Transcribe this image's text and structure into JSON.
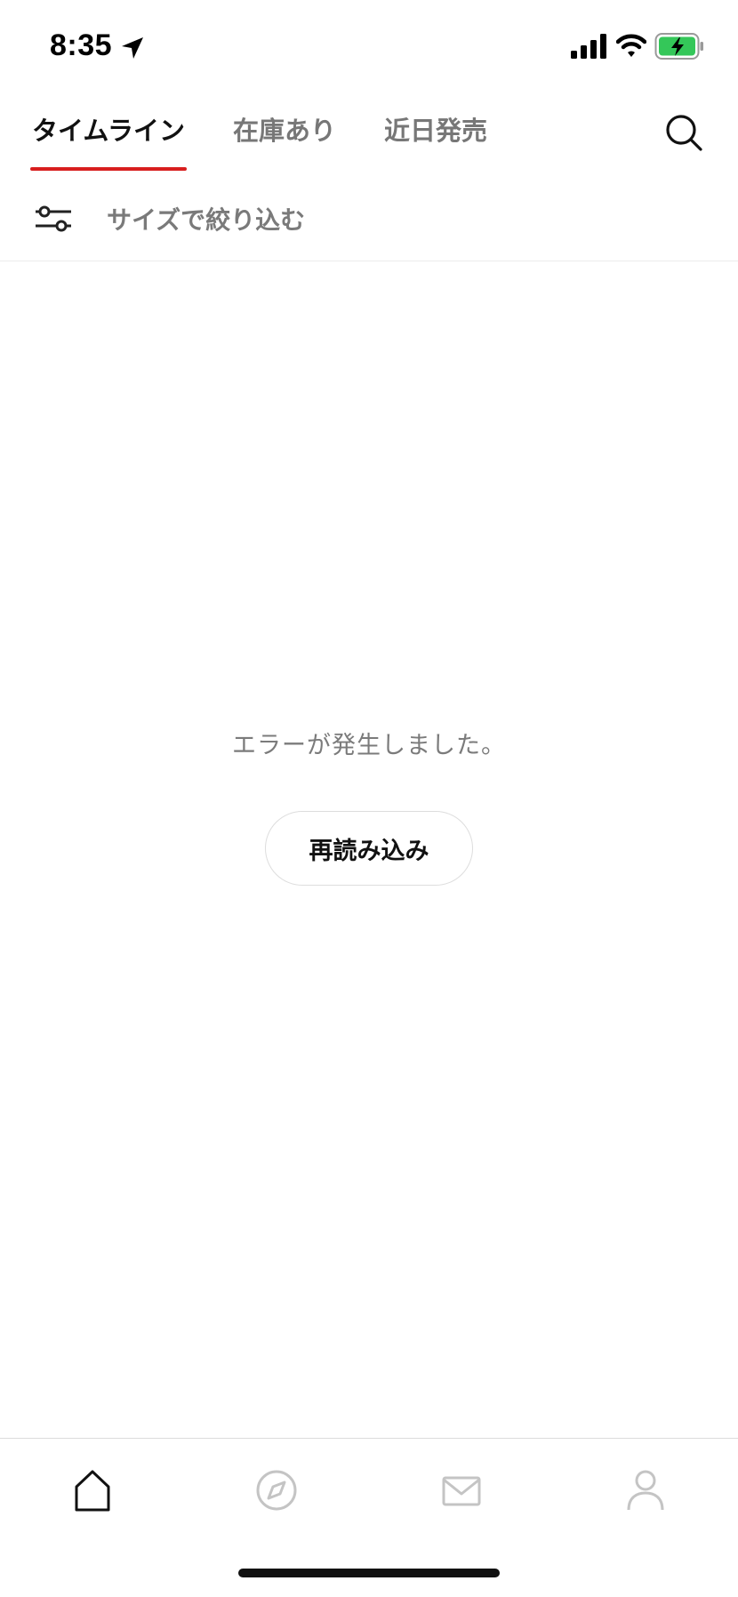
{
  "status_bar": {
    "time": "8:35",
    "icons": [
      "location-arrow-icon",
      "cellular-signal-icon",
      "wifi-icon",
      "battery-charging-icon"
    ],
    "battery_color": "#34c759"
  },
  "tabs": [
    {
      "label": "タイムライン",
      "active": true
    },
    {
      "label": "在庫あり",
      "active": false
    },
    {
      "label": "近日発売",
      "active": false
    }
  ],
  "accent_color": "#d81e1e",
  "search_icon": "search-icon",
  "filter": {
    "icon": "sliders-icon",
    "label": "サイズで絞り込む"
  },
  "error": {
    "message": "エラーが発生しました。",
    "reload_label": "再読み込み"
  },
  "bottom_nav": [
    {
      "icon": "home-icon",
      "active": true
    },
    {
      "icon": "compass-icon",
      "active": false
    },
    {
      "icon": "mail-icon",
      "active": false
    },
    {
      "icon": "profile-icon",
      "active": false
    }
  ]
}
